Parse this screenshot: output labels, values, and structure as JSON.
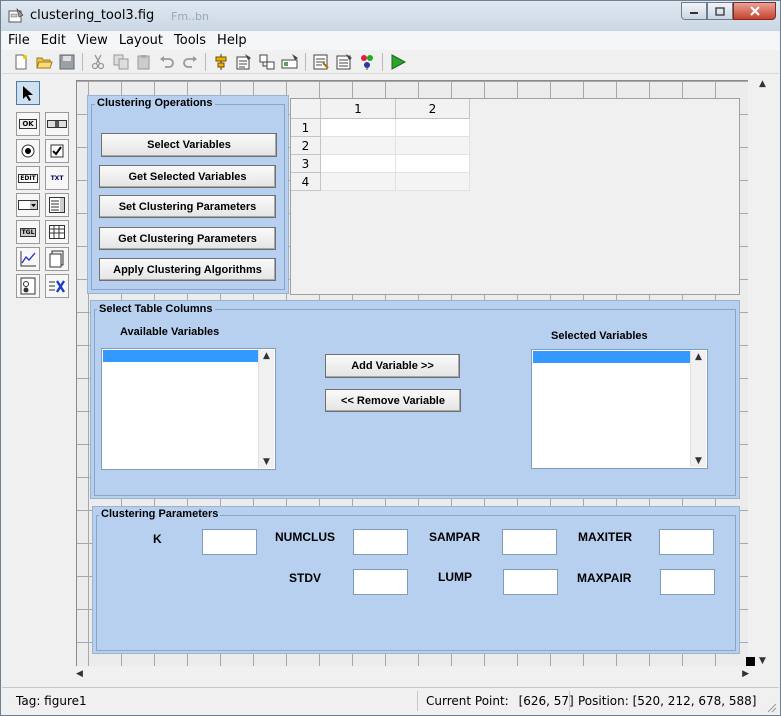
{
  "window": {
    "title": "clustering_tool3.fig",
    "background_title_ghost": "Fm..bn"
  },
  "menu": [
    "File",
    "Edit",
    "View",
    "Layout",
    "Tools",
    "Help"
  ],
  "palette": {
    "push_button": "OK",
    "edit_text": "EDIT",
    "static_text": "TXT",
    "toggle_button": "TGL"
  },
  "table": {
    "columns": [
      "1",
      "2"
    ],
    "rows": [
      "1",
      "2",
      "3",
      "4"
    ]
  },
  "clustering_operations": {
    "title": "Clustering Operations",
    "buttons": [
      "Select Variables",
      "Get Selected Variables",
      "Set Clustering Parameters",
      "Get Clustering Parameters",
      "Apply Clustering Algorithms"
    ]
  },
  "select_table_columns": {
    "title": "Select Table Columns",
    "available_label": "Available Variables",
    "selected_label": "Selected Variables",
    "add_button": "Add Variable >>",
    "remove_button": "<< Remove Variable"
  },
  "clustering_parameters": {
    "title": "Clustering Parameters",
    "labels": [
      "K",
      "NUMCLUS",
      "SAMPAR",
      "MAXITER",
      "STDV",
      "LUMP",
      "MAXPAIR"
    ]
  },
  "status": {
    "tag": "Tag: figure1",
    "current_point_label": "Current Point:",
    "current_point": "[626, 57]",
    "position_label": "Position:",
    "position": "[520, 212, 678, 588]"
  },
  "colors": {
    "panel": "#b8d0ef",
    "selection": "#3399ff",
    "run_green": "#2aa52a"
  }
}
